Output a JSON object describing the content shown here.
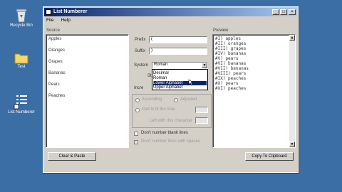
{
  "desktop": {
    "icons": [
      {
        "label": "Recycle Bin",
        "icon": "recycle-bin-icon"
      },
      {
        "label": "Test",
        "icon": "folder-icon"
      },
      {
        "label": "List Numberer",
        "icon": "list-numberer-shortcut-icon"
      }
    ]
  },
  "window": {
    "title": "List Numberer",
    "controls": {
      "minimize": "_",
      "maximize": "□",
      "close": "×"
    }
  },
  "menu": {
    "file": "File",
    "help": "Help"
  },
  "source": {
    "label": "Source",
    "lines": [
      "Apples",
      "Oranges",
      "Grapes",
      "Bananas",
      "Pears",
      "Peaches"
    ]
  },
  "prefix": {
    "label": "Prefix",
    "value": "("
  },
  "suffix": {
    "label": "Suffix",
    "value": ")"
  },
  "system": {
    "label": "System",
    "selected": "Roman",
    "options": [
      "Decimal",
      "Roman",
      "Lower Alphabet",
      "Upper Alphabet"
    ],
    "highlighted_index": 2
  },
  "start_label": "St",
  "increment_label": "Incre",
  "align": {
    "ascending": "Ascending",
    "descending": "Adjusted"
  },
  "pad_label": "Pad to fit the max",
  "pad_value_label": "Left with this character",
  "checks": {
    "dont_number_blank": "Don't number blank lines",
    "ignore": "Don't number lines with spaces"
  },
  "preview": {
    "label": "Preview",
    "lines": [
      "#I) apples",
      "#II) oranges",
      "#III) grapes",
      "#IV) bananas",
      "#V) pears",
      "#VI) bananas",
      "#VII) bananas",
      "#VIII) pears",
      "#IX) peaches",
      "#X) pears",
      "#XI) peaches"
    ]
  },
  "buttons": {
    "clear_paste": "Clear & Paste",
    "copy_clipboard": "Copy To Clipboard"
  }
}
